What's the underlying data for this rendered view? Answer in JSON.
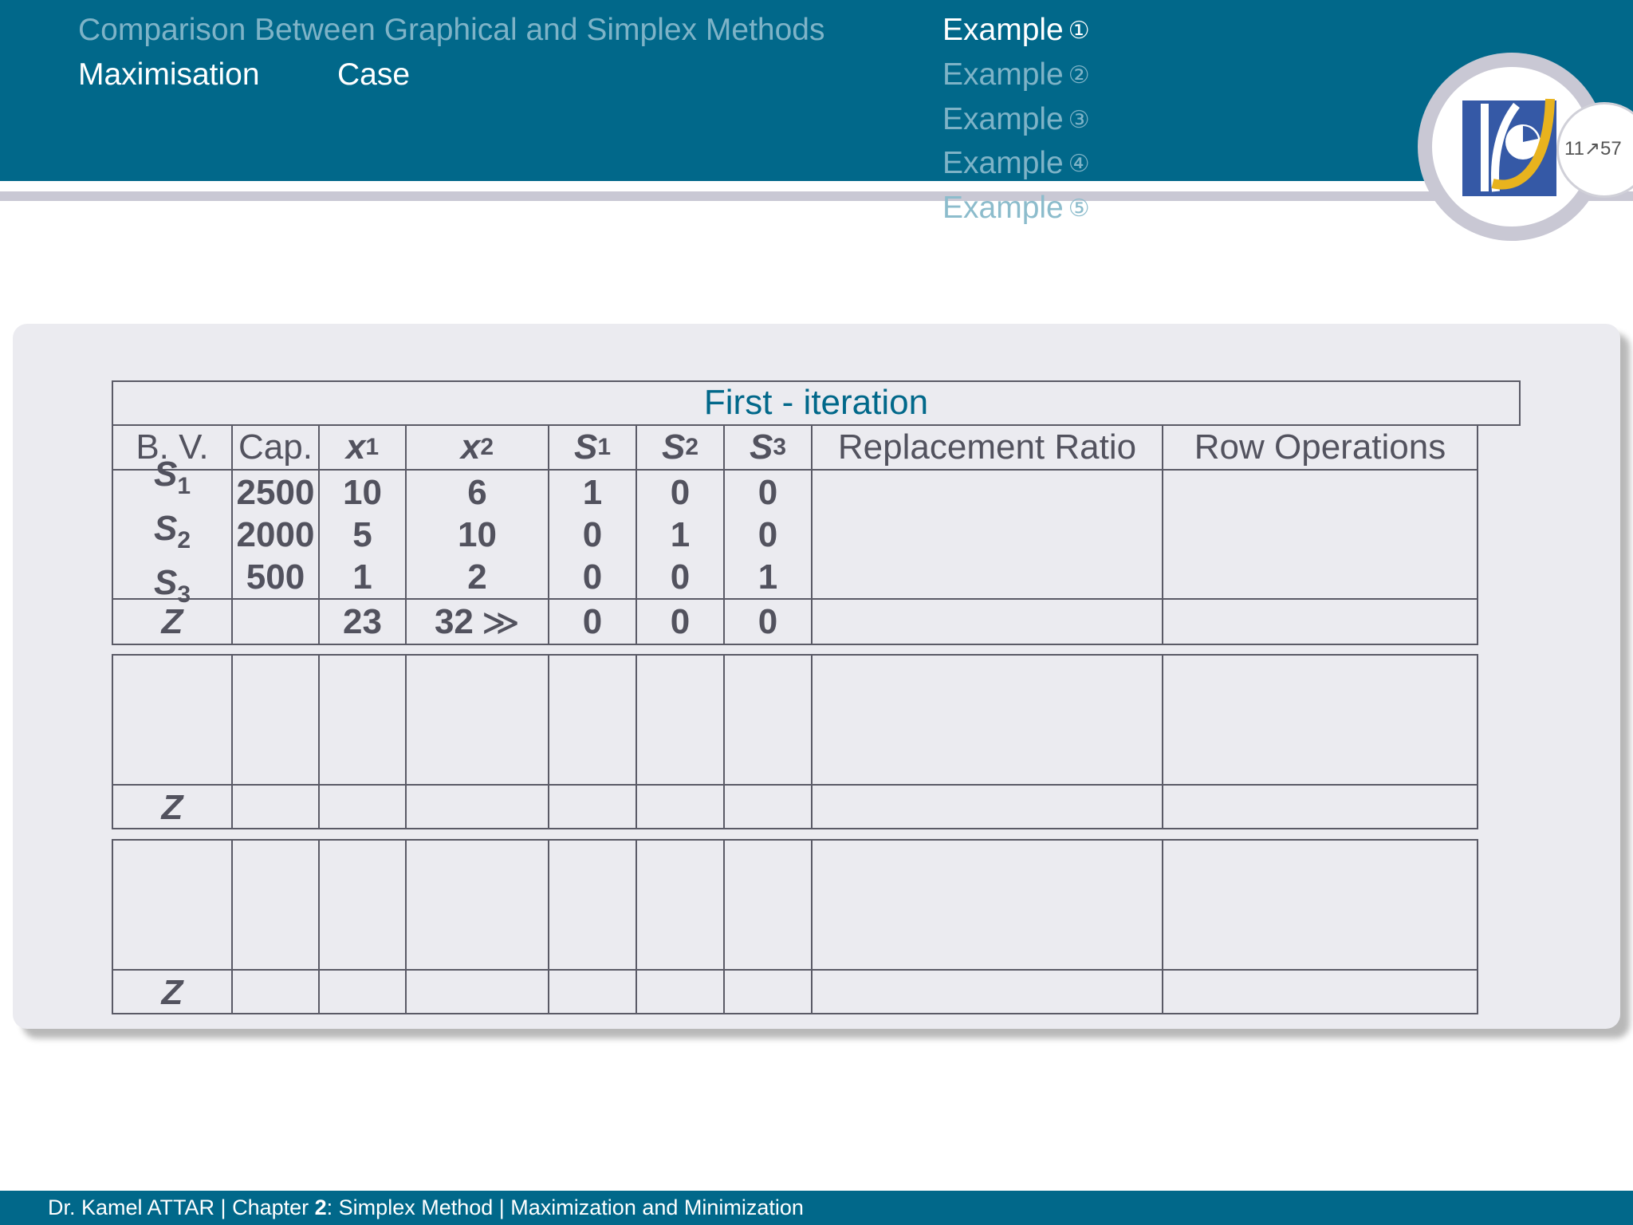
{
  "nav": {
    "section_prev": "Comparison Between Graphical and Simplex Methods",
    "section_current_a": "Maximisation",
    "section_current_b": "Case",
    "examples": [
      {
        "label": "Example",
        "num": "①"
      },
      {
        "label": "Example",
        "num": "②"
      },
      {
        "label": "Example",
        "num": "③"
      },
      {
        "label": "Example",
        "num": "④"
      },
      {
        "label": "Example",
        "num": "⑤"
      }
    ],
    "page": "11↗57"
  },
  "colors": {
    "accent": "#01688a",
    "text": "#52525e",
    "panel": "#ebebf0"
  },
  "table": {
    "title": "First - iteration",
    "headers": {
      "bv": "B. V.",
      "cap": "Cap.",
      "x1": "x",
      "x1_sub": "1",
      "x2": "x",
      "x2_sub": "2",
      "s1": "S",
      "s1_sub": "1",
      "s2": "S",
      "s2_sub": "2",
      "s3": "S",
      "s3_sub": "3",
      "ratio": "Replacement Ratio",
      "ops": "Row Operations"
    },
    "rows": [
      {
        "bv": "S",
        "sub": "1",
        "cap": "2500",
        "x1": "10",
        "x2": "6",
        "s1": "1",
        "s2": "0",
        "s3": "0"
      },
      {
        "bv": "S",
        "sub": "2",
        "cap": "2000",
        "x1": "5",
        "x2": "10",
        "s1": "0",
        "s2": "1",
        "s3": "0"
      },
      {
        "bv": "S",
        "sub": "3",
        "cap": "500",
        "x1": "1",
        "x2": "2",
        "s1": "0",
        "s2": "0",
        "s3": "1"
      }
    ],
    "z_row": {
      "label": "Z",
      "x1": "23",
      "x2": "32",
      "arrow": "≫",
      "s1": "0",
      "s2": "0",
      "s3": "0"
    },
    "z_label": "Z"
  },
  "footer": {
    "author": "Dr. Kamel ATTAR",
    "sep": " | ",
    "chapter_word": "Chapter ",
    "chapter_num": "2",
    "chapter_title": ": Simplex Method",
    "topic": "Maximization and Minimization"
  }
}
